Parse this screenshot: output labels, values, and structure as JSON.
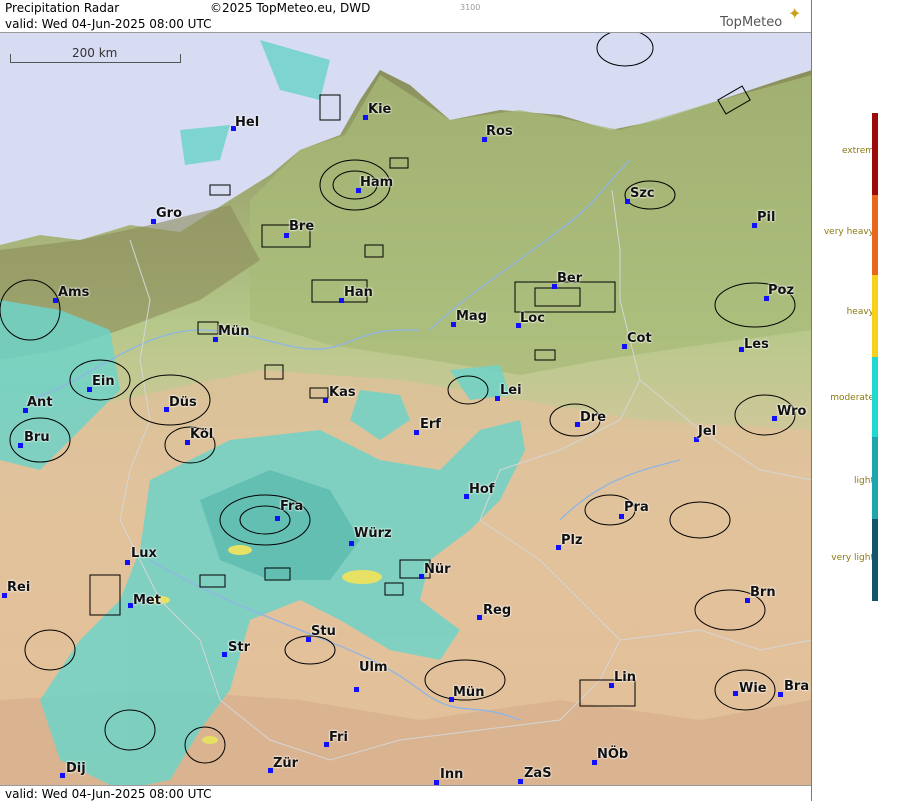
{
  "header": {
    "product": "Precipitation Radar",
    "copyright": "©2025 TopMeteo.eu, DWD",
    "tag": "3100",
    "brand": "TopMeteo",
    "valid": "valid:  Wed  04-Jun-2025 08:00 UTC"
  },
  "scale_bar": {
    "label": "200 km"
  },
  "footer": {
    "valid": "valid:  Wed  04-Jun-2025 08:00 UTC"
  },
  "cities": [
    "Hel",
    "Kie",
    "Ros",
    "Ham",
    "Szc",
    "Gro",
    "Bre",
    "Pil",
    "Ams",
    "Ber",
    "Poz",
    "Han",
    "Mag",
    "Loc",
    "Mün",
    "Cot",
    "Les",
    "Ein",
    "Kas",
    "Lei",
    "Ant",
    "Düs",
    "Dre",
    "Wro",
    "Bru",
    "Köl",
    "Erf",
    "Jel",
    "Hof",
    "Fra",
    "Pra",
    "Würz",
    "Plz",
    "Lux",
    "Nür",
    "Rei",
    "Met",
    "Reg",
    "Brn",
    "Stu",
    "Str",
    "Ulm",
    "Lin",
    "Mün",
    "Wie",
    "Bra",
    "Fri",
    "Dij",
    "Zür",
    "Inn",
    "ZaS",
    "NÖb"
  ],
  "legend": {
    "labels": [
      "extrem",
      "very heavy",
      "heavy",
      "moderate",
      "light",
      "very light"
    ],
    "colors": [
      "#9e0a0a",
      "#e8671c",
      "#f6d21a",
      "#20d8d0",
      "#1da6ac",
      "#14546a"
    ]
  }
}
